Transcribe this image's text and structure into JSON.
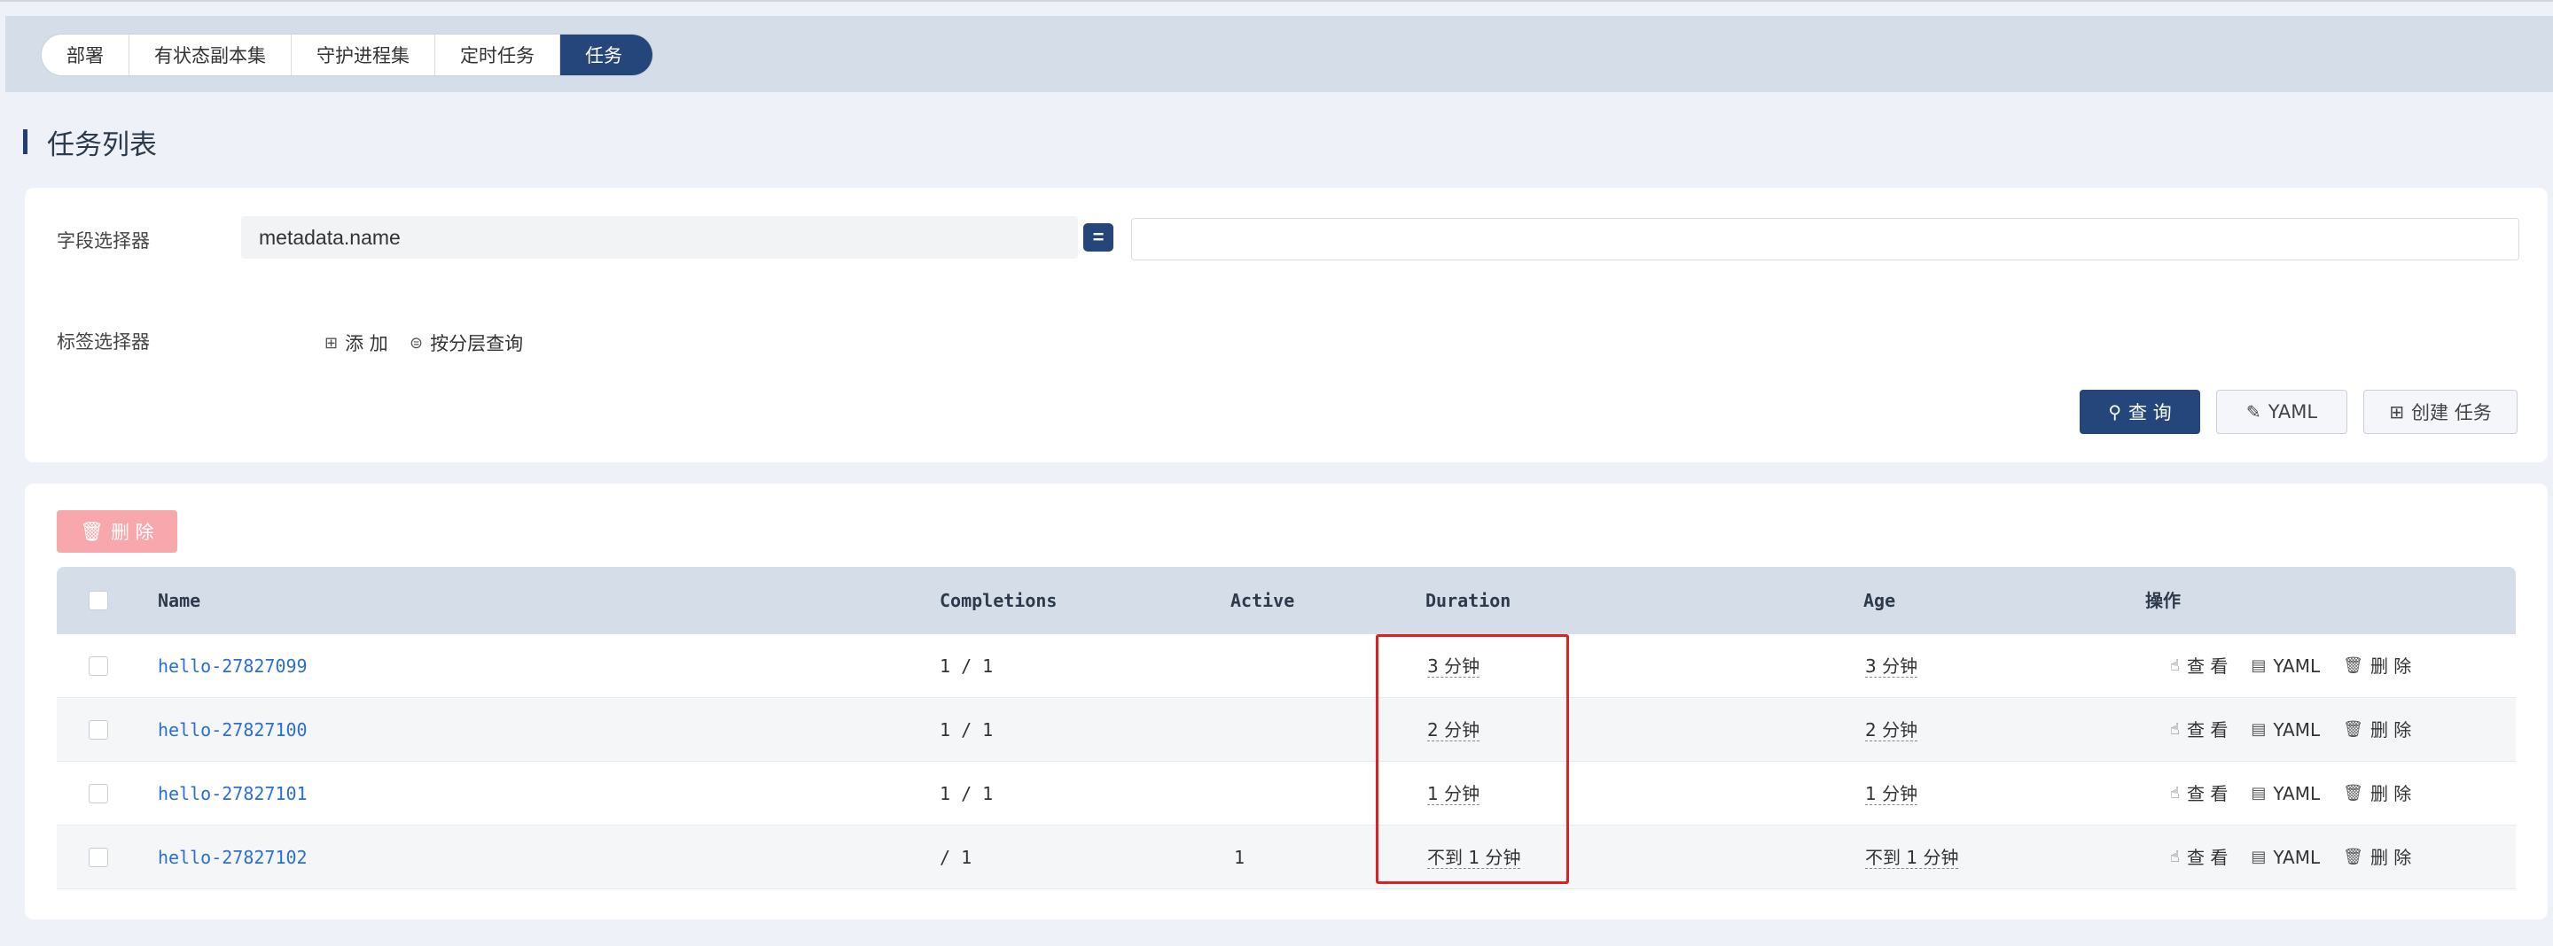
{
  "tabs": [
    {
      "label": "部署"
    },
    {
      "label": "有状态副本集"
    },
    {
      "label": "守护进程集"
    },
    {
      "label": "定时任务"
    },
    {
      "label": "任务",
      "active": true
    }
  ],
  "page_title": "任务列表",
  "filter": {
    "field_selector_label": "字段选择器",
    "field_selector_value": "metadata.name",
    "operator": "=",
    "field_value": "",
    "label_selector_label": "标签选择器",
    "add_label": "添 加",
    "layered_query_label": "按分层查询"
  },
  "buttons": {
    "query": "查 询",
    "yaml": "YAML",
    "create": "创建 任务",
    "delete": "删 除"
  },
  "table": {
    "headers": {
      "name": "Name",
      "completions": "Completions",
      "active": "Active",
      "duration": "Duration",
      "age": "Age",
      "actions": "操作"
    },
    "rows": [
      {
        "name": "hello-27827099",
        "completions": "1 / 1",
        "active": "",
        "duration": "3 分钟",
        "age": "3 分钟"
      },
      {
        "name": "hello-27827100",
        "completions": "1 / 1",
        "active": "",
        "duration": "2 分钟",
        "age": "2 分钟"
      },
      {
        "name": "hello-27827101",
        "completions": "1 / 1",
        "active": "",
        "duration": "1 分钟",
        "age": "1 分钟"
      },
      {
        "name": "hello-27827102",
        "completions": "/ 1",
        "active": "1",
        "duration": "不到 1 分钟",
        "age": "不到 1 分钟"
      }
    ],
    "row_actions": {
      "view": "查 看",
      "yaml": "YAML",
      "delete": "删 除"
    }
  },
  "colors": {
    "primary": "#25467a",
    "link": "#2a6fd1",
    "delete_disabled": "#f8a7ad",
    "highlight_box": "#e02020"
  }
}
